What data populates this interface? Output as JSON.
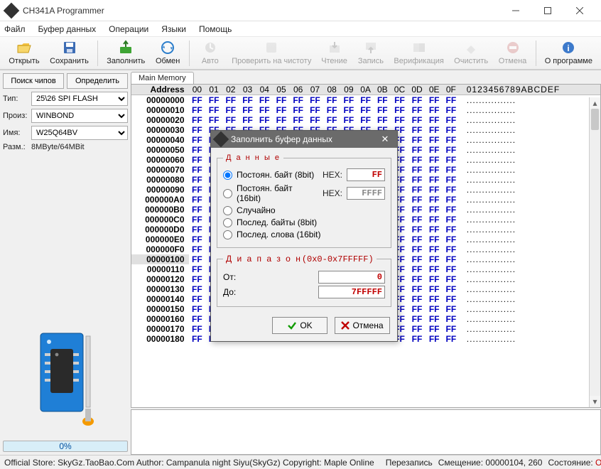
{
  "window": {
    "title": "CH341A Programmer"
  },
  "menus": [
    "Файл",
    "Буфер данных",
    "Операции",
    "Языки",
    "Помощь"
  ],
  "toolbar": [
    {
      "key": "open",
      "label": "Открыть",
      "enabled": true
    },
    {
      "key": "save",
      "label": "Сохранить",
      "enabled": true
    },
    {
      "key": "sep"
    },
    {
      "key": "fill",
      "label": "Заполнить",
      "enabled": true
    },
    {
      "key": "swap",
      "label": "Обмен",
      "enabled": true
    },
    {
      "key": "sep"
    },
    {
      "key": "auto",
      "label": "Авто",
      "enabled": false
    },
    {
      "key": "blank",
      "label": "Проверить на чистоту",
      "enabled": false
    },
    {
      "key": "read",
      "label": "Чтение",
      "enabled": false
    },
    {
      "key": "write",
      "label": "Запись",
      "enabled": false
    },
    {
      "key": "verify",
      "label": "Верификация",
      "enabled": false
    },
    {
      "key": "erase",
      "label": "Очистить",
      "enabled": false
    },
    {
      "key": "cancel",
      "label": "Отмена",
      "enabled": false
    },
    {
      "key": "sep"
    },
    {
      "key": "about",
      "label": "О программе",
      "enabled": true
    }
  ],
  "left": {
    "search": "Поиск чипов",
    "detect": "Определить",
    "type_label": "Тип:",
    "type_value": "25\\26 SPI FLASH",
    "manu_label": "Произ:",
    "manu_value": "WINBOND",
    "name_label": "Имя:",
    "name_value": "W25Q64BV",
    "size_label": "Разм.:",
    "size_value": "8MByte/64MBit",
    "progress": "0%"
  },
  "hex": {
    "tab": "Main Memory",
    "addr_header": "Address",
    "columns": [
      "00",
      "01",
      "02",
      "03",
      "04",
      "05",
      "06",
      "07",
      "08",
      "09",
      "0A",
      "0B",
      "0C",
      "0D",
      "0E",
      "0F"
    ],
    "ascii_header": "0123456789ABCDEF",
    "row_count": 25,
    "start_addr": 0,
    "byte": "FF",
    "ascii_row": "................",
    "selected_row": 16
  },
  "dialog": {
    "title": "Заполнить буфер данных",
    "group_data": "Д а н н ы е",
    "group_range": "Д и а п а з о н",
    "range_suffix": "(0x0-0x7FFFFF)",
    "radios": [
      {
        "label": "Постоян. байт (8bit)",
        "hex": true,
        "value": "FF",
        "checked": true
      },
      {
        "label": "Постоян. байт (16bit)",
        "hex": true,
        "value": "FFFF",
        "gray": true
      },
      {
        "label": "Случайно"
      },
      {
        "label": "Послед. байты (8bit)"
      },
      {
        "label": "Послед. слова (16bit)"
      }
    ],
    "hex_label": "HEX:",
    "from_label": "От:",
    "to_label": "До:",
    "from_value": "0",
    "to_value": "7FFFFF",
    "ok": "OK",
    "cancel": "Отмена"
  },
  "status": {
    "store": "Official Store: SkyGz.TaoBao.Com Author: Campanula night Siyu(SkyGz) Copyright: Maple Online",
    "rewrite": "Перезапись",
    "offset_label": "Смещение:",
    "offset_value": "00000104, 260",
    "state_label": "Состояние:",
    "state_value": "Отключено"
  },
  "colors": {
    "accent": "#0000c0",
    "danger": "#c00000"
  }
}
